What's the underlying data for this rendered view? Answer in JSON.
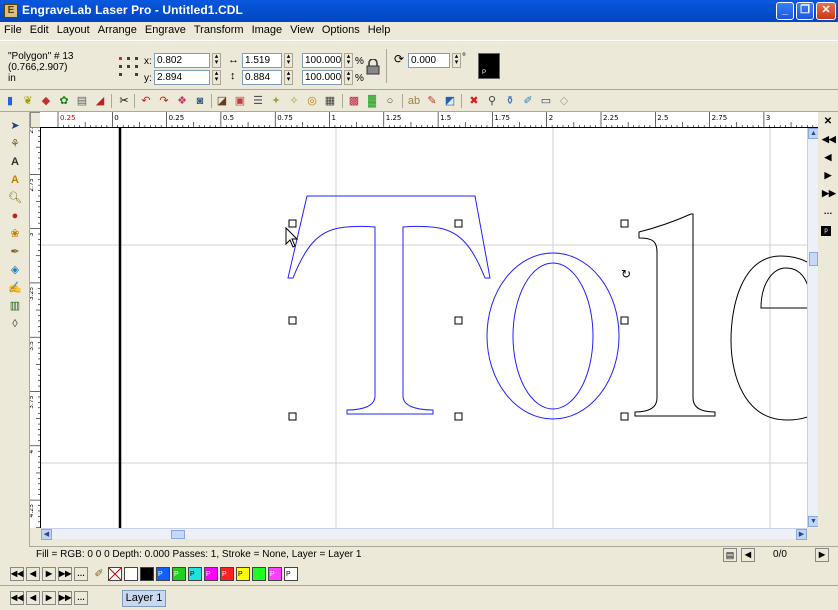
{
  "window": {
    "title": "EngraveLab Laser Pro - Untitled1.CDL"
  },
  "menu": [
    "File",
    "Edit",
    "Layout",
    "Arrange",
    "Engrave",
    "Transform",
    "Image",
    "View",
    "Options",
    "Help"
  ],
  "props": {
    "object_name": "\"Polygon\" # 13",
    "coords": "(0.766,2.907)",
    "units": "in",
    "x_label": "x:",
    "x_value": "0.802",
    "y_label": "y:",
    "y_value": "2.894",
    "width_value": "1.519",
    "height_value": "0.884",
    "scale_w": "100.000",
    "scale_h": "100.000",
    "percent": "%",
    "rotation": "0.000",
    "degree": "°"
  },
  "rulers": {
    "h_ticks": [
      "0.25",
      "0",
      "0.25",
      "0.5",
      "0.75",
      "1",
      "1.25",
      "1.5",
      "1.75",
      "2",
      "2.25",
      "2.5",
      "2.75",
      "3"
    ],
    "v_ticks": [
      "2.5",
      "2.75",
      "3",
      "3.25",
      "3.5",
      "3.75",
      "4",
      "4.25"
    ]
  },
  "canvas": {
    "text": "Tole"
  },
  "status": {
    "text": "Fill = RGB: 0 0 0 Depth: 0.000 Passes: 1, Stroke = None, Layer = Layer 1",
    "page_counter": "0/0"
  },
  "swatches": [
    {
      "label": "",
      "color": "#ffffff"
    },
    {
      "label": "",
      "color": "#000000"
    },
    {
      "label": "P",
      "color": "#1060ff"
    },
    {
      "label": "P",
      "color": "#20d020"
    },
    {
      "label": "P",
      "color": "#20e0e0"
    },
    {
      "label": "P",
      "color": "#ff00ff"
    },
    {
      "label": "P",
      "color": "#ff2020"
    },
    {
      "label": "P",
      "color": "#ffff00"
    },
    {
      "label": "",
      "color": "#20ff20"
    },
    {
      "label": "P",
      "color": "#ff40ff"
    },
    {
      "label": "P",
      "color": "#ffffff"
    }
  ],
  "layers": {
    "active": "Layer 1"
  },
  "colors": {
    "selection": "#2020ff",
    "grid": "#d0d0d0",
    "titlebar": "#0450d0"
  }
}
